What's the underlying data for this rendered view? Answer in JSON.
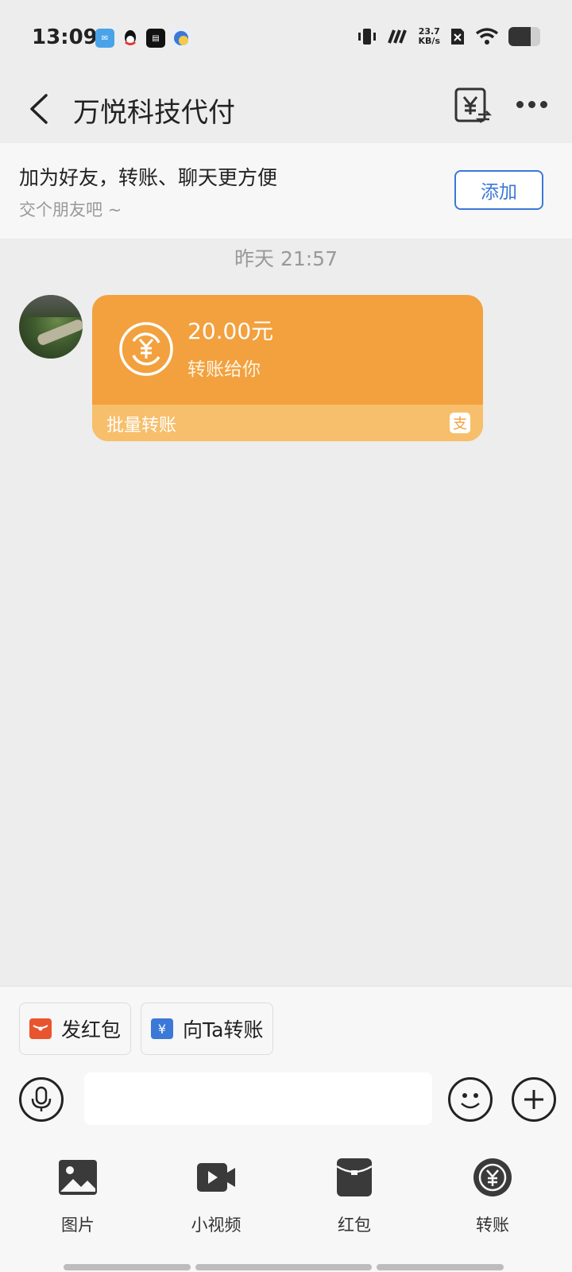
{
  "status_bar": {
    "time": "13:09",
    "net_speed_value": "23.7",
    "net_speed_unit": "KB/s",
    "battery_level_percent": 70
  },
  "header": {
    "title": "万悦科技代付"
  },
  "banner": {
    "title": "加为好友，转账、聊天更方便",
    "subtitle": "交个朋友吧 ~",
    "add_button": "添加"
  },
  "chat": {
    "timestamp": "昨天 21:57",
    "transfer": {
      "amount": "20.00元",
      "description": "转账给你",
      "footer_label": "批量转账",
      "accent_color": "#f2a13e"
    }
  },
  "bottom": {
    "quick_actions": [
      {
        "label": "发红包",
        "icon": "red-envelope-icon",
        "color": "#e8542e"
      },
      {
        "label": "向Ta转账",
        "icon": "yen-card-icon",
        "color": "#3b78d8"
      }
    ],
    "input_placeholder": "",
    "tools": [
      {
        "label": "图片",
        "icon": "image-icon"
      },
      {
        "label": "小视频",
        "icon": "video-icon"
      },
      {
        "label": "红包",
        "icon": "red-packet-icon"
      },
      {
        "label": "转账",
        "icon": "transfer-icon"
      }
    ]
  }
}
